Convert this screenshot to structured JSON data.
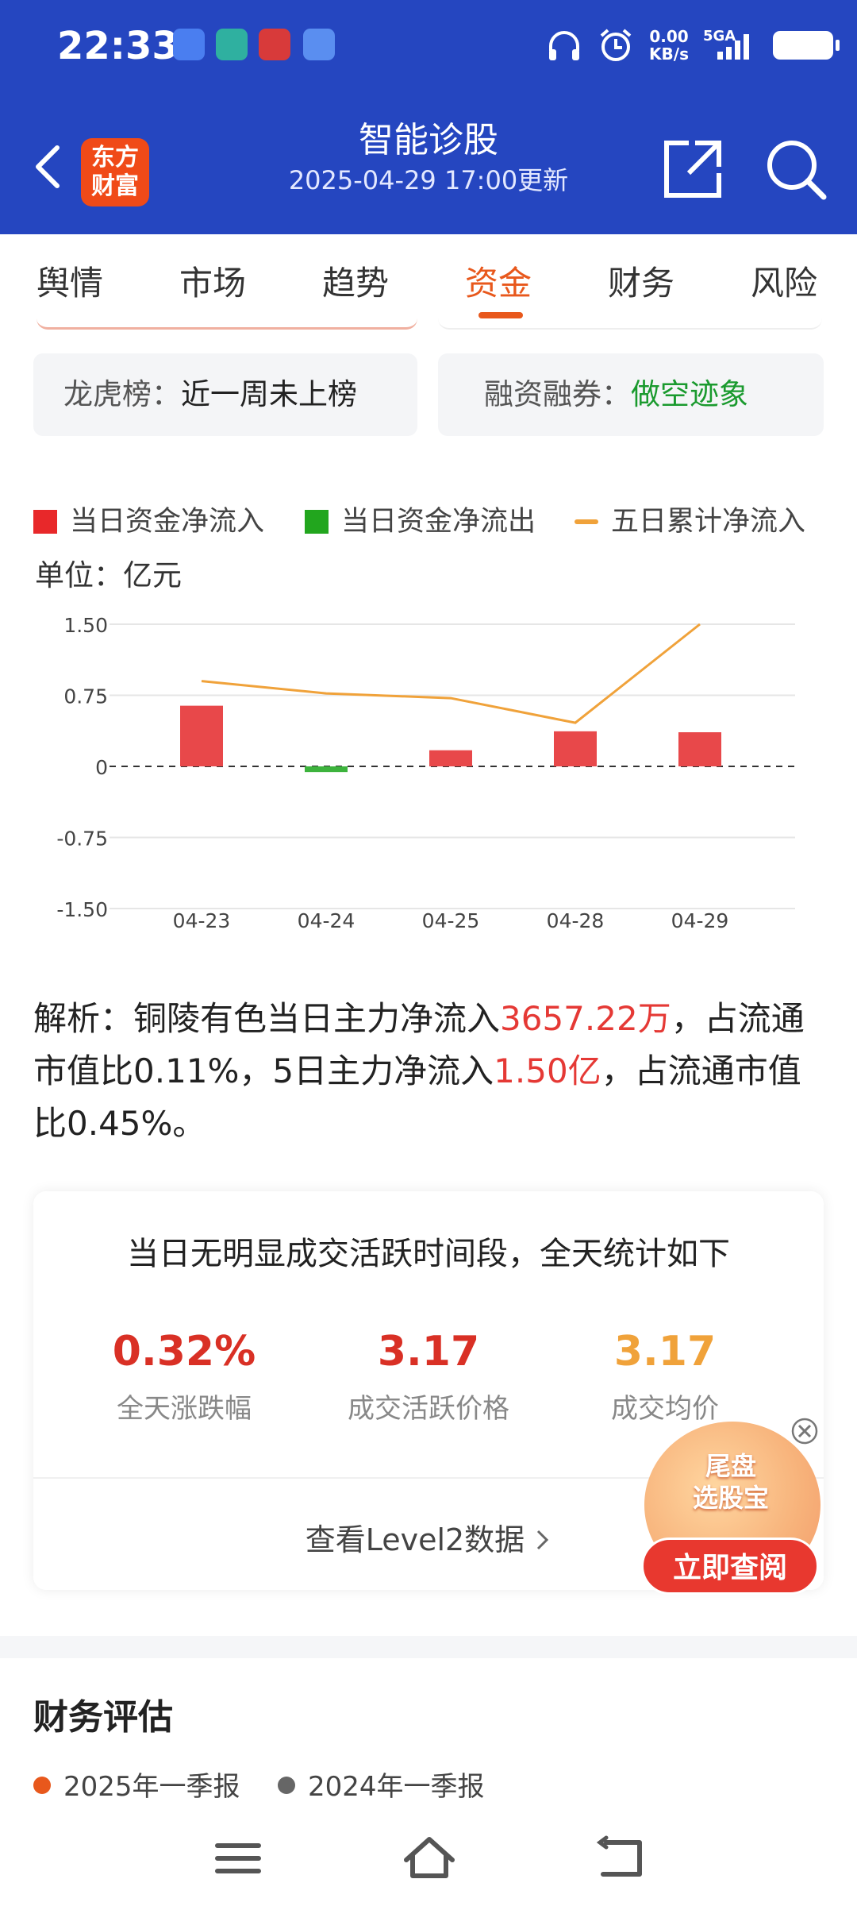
{
  "status_bar": {
    "time": "22:33",
    "net_speed": "0.00",
    "net_unit": "KB/s",
    "signal": "5GA"
  },
  "header": {
    "logo_line1": "东方",
    "logo_line2": "财富",
    "title": "智能诊股",
    "subtitle": "2025-04-29 17:00更新"
  },
  "tabs": [
    "舆情",
    "市场",
    "趋势",
    "资金",
    "财务",
    "风险"
  ],
  "active_tab": "资金",
  "info_pills": {
    "left": {
      "label": "龙虎榜：",
      "value": "近一周未上榜"
    },
    "right": {
      "label": "融资融券：",
      "value": "做空迹象"
    }
  },
  "legend": {
    "inflow": "当日资金净流入",
    "outflow": "当日资金净流出",
    "cumulative": "五日累计净流入"
  },
  "unit_label": "单位：亿元",
  "chart_data": {
    "type": "bar",
    "categories": [
      "04-23",
      "04-24",
      "04-25",
      "04-28",
      "04-29"
    ],
    "series": [
      {
        "name": "当日资金净流入",
        "type": "bar",
        "values": [
          0.64,
          -0.06,
          0.17,
          0.37,
          0.36
        ]
      },
      {
        "name": "五日累计净流入",
        "type": "line",
        "values": [
          0.9,
          0.77,
          0.72,
          0.46,
          1.5
        ]
      }
    ],
    "yticks": [
      "1.50",
      "0.75",
      "0",
      "-0.75",
      "-1.50"
    ],
    "ylim": [
      -1.5,
      1.5
    ],
    "colors": {
      "inflow": "#e8484a",
      "outflow": "#3db33d",
      "line": "#f0a23a",
      "grid": "#e6e6e6"
    }
  },
  "analysis": {
    "p1": "解析：铜陵有色当日主力净流入",
    "v1": "3657.22万",
    "p2": "，占流通市值比0.11%，5日主力净流入",
    "v2": "1.50亿",
    "p3": "，占流通市值比0.45%。"
  },
  "summary_card": {
    "title": "当日无明显成交活跃时间段，全天统计如下",
    "stats": [
      {
        "value": "0.32%",
        "caption": "全天涨跌幅",
        "color": "#d93025"
      },
      {
        "value": "3.17",
        "caption": "成交活跃价格",
        "color": "#d93025"
      },
      {
        "value": "3.17",
        "caption": "成交均价",
        "color": "#f0a23a"
      }
    ],
    "link": "查看Level2数据"
  },
  "ad": {
    "line1": "尾盘",
    "line2": "选股宝",
    "button": "立即查阅"
  },
  "finance": {
    "title": "财务评估",
    "legend": [
      {
        "label": "2025年一季报",
        "color": "#e8581c"
      },
      {
        "label": "2024年一季报",
        "color": "#666666"
      }
    ]
  }
}
